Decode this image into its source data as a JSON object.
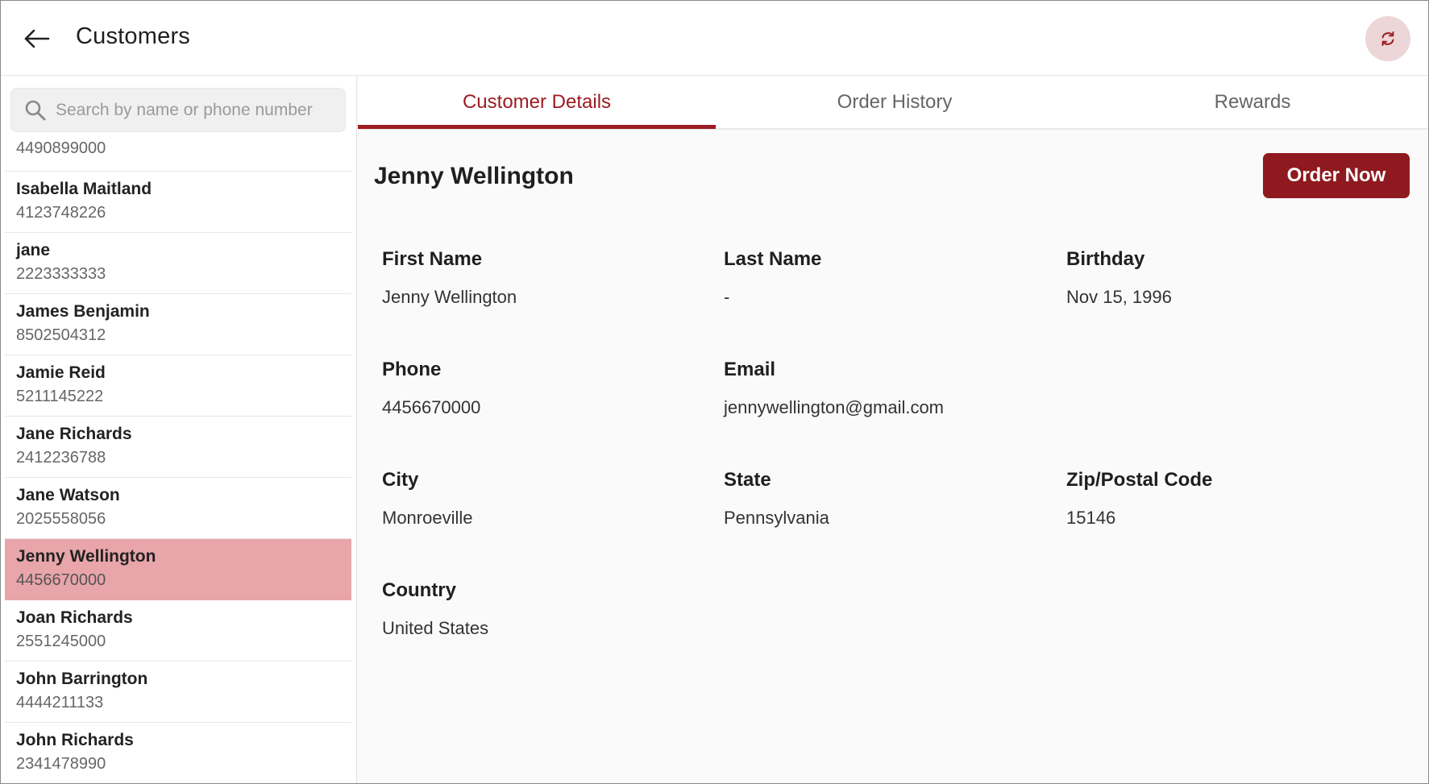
{
  "header": {
    "title": "Customers",
    "back_icon": "arrow-left-icon",
    "refresh_icon": "refresh-icon",
    "accent_color": "#9b1c22"
  },
  "search": {
    "placeholder": "Search by name or phone number",
    "value": ""
  },
  "customers": [
    {
      "name": "",
      "phone": "4490899000"
    },
    {
      "name": "Isabella Maitland",
      "phone": "4123748226"
    },
    {
      "name": "jane",
      "phone": "2223333333"
    },
    {
      "name": "James Benjamin",
      "phone": "8502504312"
    },
    {
      "name": "Jamie Reid",
      "phone": "5211145222"
    },
    {
      "name": "Jane Richards",
      "phone": "2412236788"
    },
    {
      "name": "Jane Watson",
      "phone": "2025558056"
    },
    {
      "name": "Jenny Wellington",
      "phone": "4456670000",
      "selected": true
    },
    {
      "name": "Joan Richards",
      "phone": "2551245000"
    },
    {
      "name": "John Barrington",
      "phone": "4444211133"
    },
    {
      "name": "John Richards",
      "phone": "2341478990"
    }
  ],
  "tabs": [
    {
      "label": "Customer Details",
      "active": true
    },
    {
      "label": "Order History",
      "active": false
    },
    {
      "label": "Rewards",
      "active": false
    }
  ],
  "details": {
    "name": "Jenny Wellington",
    "order_button": "Order Now",
    "fields": {
      "first_name": {
        "label": "First Name",
        "value": "Jenny Wellington"
      },
      "last_name": {
        "label": "Last Name",
        "value": "-"
      },
      "birthday": {
        "label": "Birthday",
        "value": "Nov 15, 1996"
      },
      "phone": {
        "label": "Phone",
        "value": "4456670000"
      },
      "email": {
        "label": "Email",
        "value": "jennywellington@gmail.com"
      },
      "city": {
        "label": "City",
        "value": "Monroeville"
      },
      "state": {
        "label": "State",
        "value": "Pennsylvania"
      },
      "zip": {
        "label": "Zip/Postal Code",
        "value": "15146"
      },
      "country": {
        "label": "Country",
        "value": "United States"
      }
    }
  }
}
